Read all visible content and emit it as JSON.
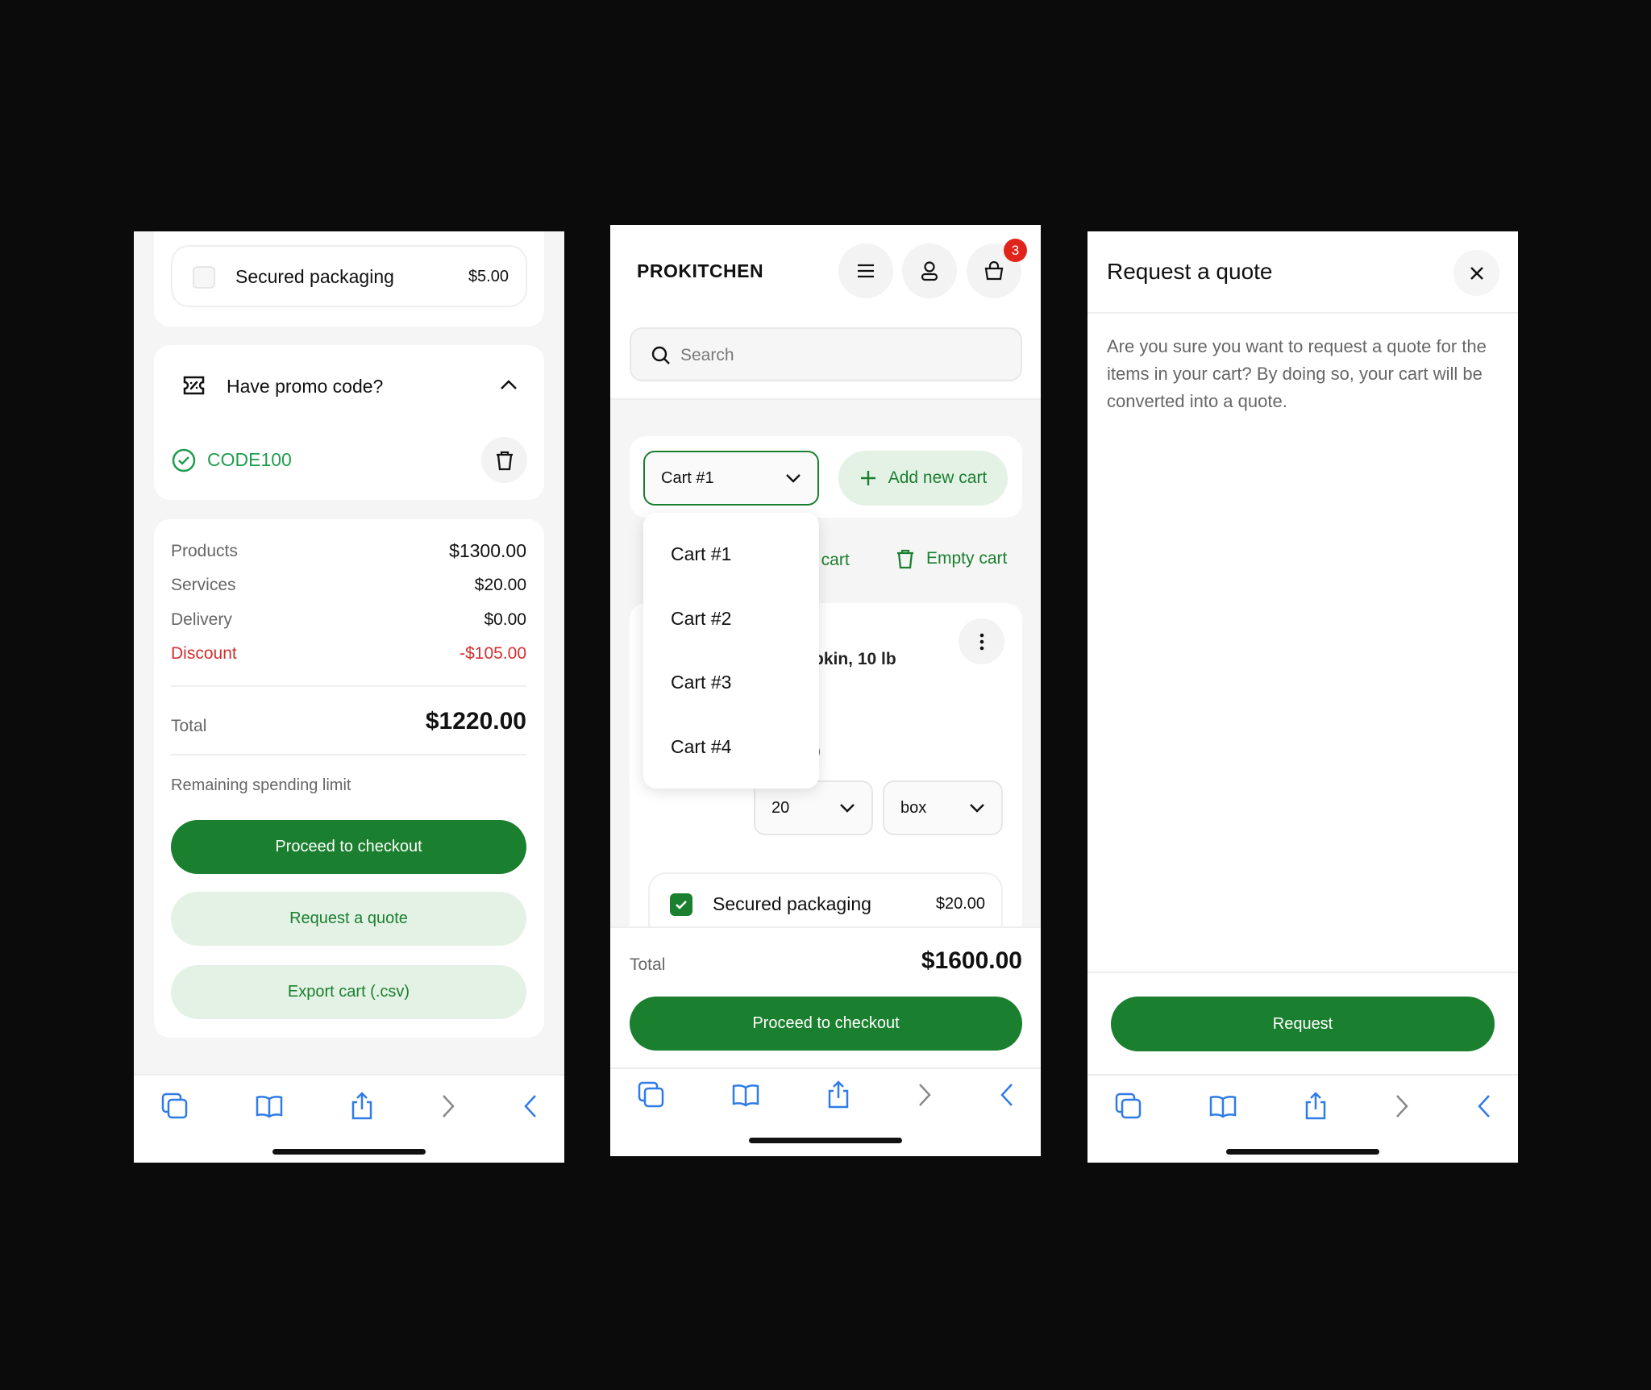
{
  "colors": {
    "accent": "#1a7f2e",
    "accent_soft": "#e4f2e6",
    "discount": "#d32f2f",
    "badge": "#e0241b",
    "toolbar_icon": "#2f7be8"
  },
  "screen1": {
    "packaging": {
      "label": "Secured packaging",
      "price": "$5.00",
      "checked": false
    },
    "promo": {
      "title": "Have promo code?",
      "code": "CODE100"
    },
    "summary": {
      "rows": [
        {
          "label": "Products",
          "value": "$1300.00"
        },
        {
          "label": "Services",
          "value": "$20.00"
        },
        {
          "label": "Delivery",
          "value": "$0.00"
        }
      ],
      "discount": {
        "label": "Discount",
        "value": "-$105.00"
      },
      "total_label": "Total",
      "total_value": "$1220.00",
      "spending_limit": "Remaining spending limit"
    },
    "buttons": {
      "checkout": "Proceed to checkout",
      "quote": "Request a quote",
      "export": "Export cart (.csv)"
    }
  },
  "screen2": {
    "brand": "PROKITCHEN",
    "cart_badge": "3",
    "search": {
      "placeholder": "Search"
    },
    "cart_select": "Cart #1",
    "add_cart": "Add new cart",
    "partial_action": "t cart",
    "empty_cart": "Empty cart",
    "dropdown": [
      "Cart #1",
      "Cart #2",
      "Cart #3",
      "Cart #4"
    ],
    "product_partial": "pkin, 10 lb",
    "partial_paren": ")",
    "qty": "20",
    "unit": "box",
    "packaging": {
      "label": "Secured packaging",
      "price": "$20.00",
      "checked": true
    },
    "total_label": "Total",
    "total_value": "$1600.00",
    "checkout": "Proceed to checkout"
  },
  "screen3": {
    "title": "Request a quote",
    "body": "Are you sure you want to request a quote for the items in your cart? By doing so, your cart will be converted into a quote.",
    "request": "Request"
  },
  "toolbar_icons": [
    "tabs-icon",
    "bookmarks-icon",
    "share-icon",
    "forward-icon",
    "back-icon"
  ]
}
